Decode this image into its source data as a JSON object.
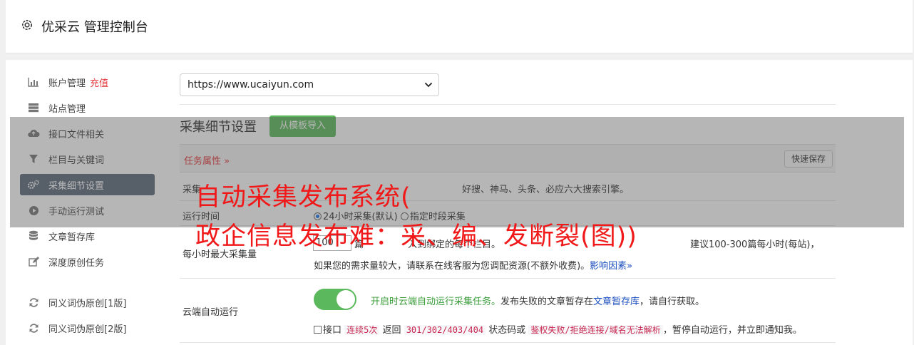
{
  "header": {
    "title": "优采云 管理控制台"
  },
  "sidebar": {
    "recharge_label": "充值",
    "items": [
      {
        "label": "账户管理",
        "icon": "bar-chart-icon"
      },
      {
        "label": "站点管理",
        "icon": "server-icon"
      },
      {
        "label": "接口文件相关",
        "icon": "cloud-upload-icon"
      },
      {
        "label": "栏目与关键词",
        "icon": "filter-icon"
      },
      {
        "label": "采集细节设置",
        "icon": "cogs-icon",
        "active": true
      },
      {
        "label": "手动运行测试",
        "icon": "play-circle-icon"
      },
      {
        "label": "文章暂存库",
        "icon": "database-icon"
      },
      {
        "label": "深度原创任务",
        "icon": "edit-icon"
      },
      {
        "label": "同义词伪原创[1版]",
        "icon": "refresh-icon"
      },
      {
        "label": "同义词伪原创[2版]",
        "icon": "refresh-icon"
      }
    ]
  },
  "main": {
    "site_select_value": "https://www.ucaiyun.com",
    "section_title": "采集细节设置",
    "import_template_button": "从模板导入",
    "task_attr_label": "任务属性",
    "quick_save_button": "快速保存",
    "collect_row_label": "采集",
    "collect_row_text": "好搜、神马、头条、必应六大搜索引擎。",
    "run_time_label": "运行时间",
    "run_time_option_1": "24小时采集(默认)",
    "run_time_option_2": "指定时段采集",
    "max_label": "每小时最大采集量",
    "max_value": "100",
    "max_text_1": "篇",
    "max_text_2": "入到绑定的每个栏目。",
    "max_text_3": "建议100-300篇每小时(每站)，",
    "max_text_4": "如果您的需求量较大，请联系在线客服为您调配资源(不额外收费)。",
    "impact_link": "影响因素",
    "cloud_label": "云端自动运行",
    "cloud_text_green": "开启时云端自动运行采集任务。",
    "cloud_text_1": "发布失败的文章暂存在",
    "cloud_link": "文章暂存库",
    "cloud_text_2": "，请自行获取。",
    "interface_prefix": "接口",
    "interface_code_1": "连续5次",
    "interface_mid_1": "返回",
    "interface_code_2": "301/302/403/404",
    "interface_mid_2": "状态码或",
    "interface_code_3": "鉴权失败/拒绝连接/域名无法解析",
    "interface_suffix": "，暂停自动运行，并立即通知我。"
  },
  "overlay": {
    "headline_1": "自动采集发布系统(",
    "headline_2": "政企信息发布难：采、编、发断裂(图))"
  }
}
